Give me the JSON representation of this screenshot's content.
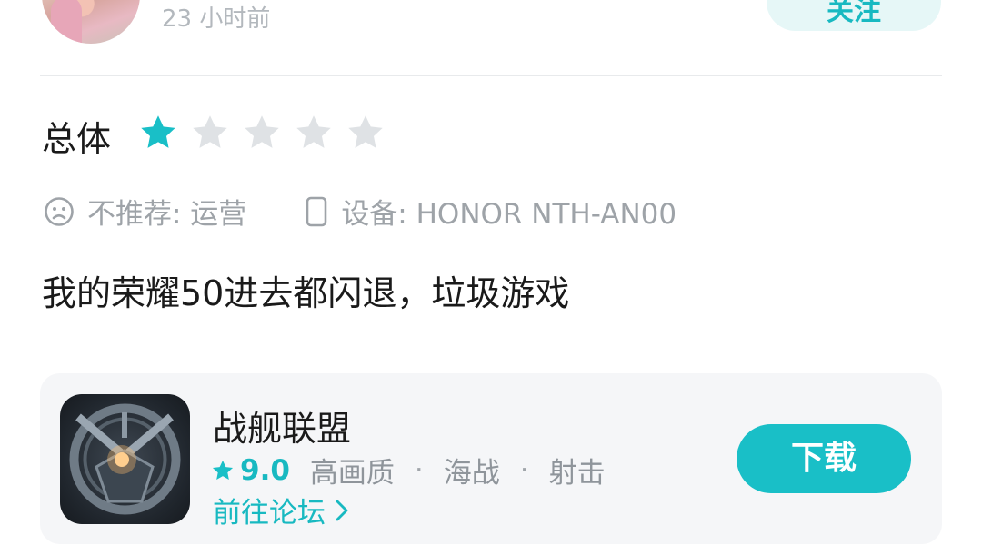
{
  "header": {
    "time_ago": "23 小时前",
    "follow_label": "关注"
  },
  "review": {
    "overall_label": "总体",
    "rating_value": 1,
    "rating_max": 5,
    "recommend_tag": "不推荐: 运营",
    "device_tag": "设备: HONOR NTH-AN00",
    "content": "我的荣耀50进去都闪退，垃圾游戏"
  },
  "app_card": {
    "name": "战舰联盟",
    "rating": "9.0",
    "tags": [
      "高画质",
      "海战",
      "射击"
    ],
    "separator": "·",
    "forum_label": "前往论坛",
    "download_label": "下载"
  },
  "colors": {
    "accent": "#19bfc7",
    "star_empty": "#dfe2e5",
    "muted_text": "#9ea3a8"
  },
  "icons": {
    "sad": "sad-face-icon",
    "device": "phone-icon",
    "star": "star-icon",
    "chevron": "chevron-right-icon"
  }
}
